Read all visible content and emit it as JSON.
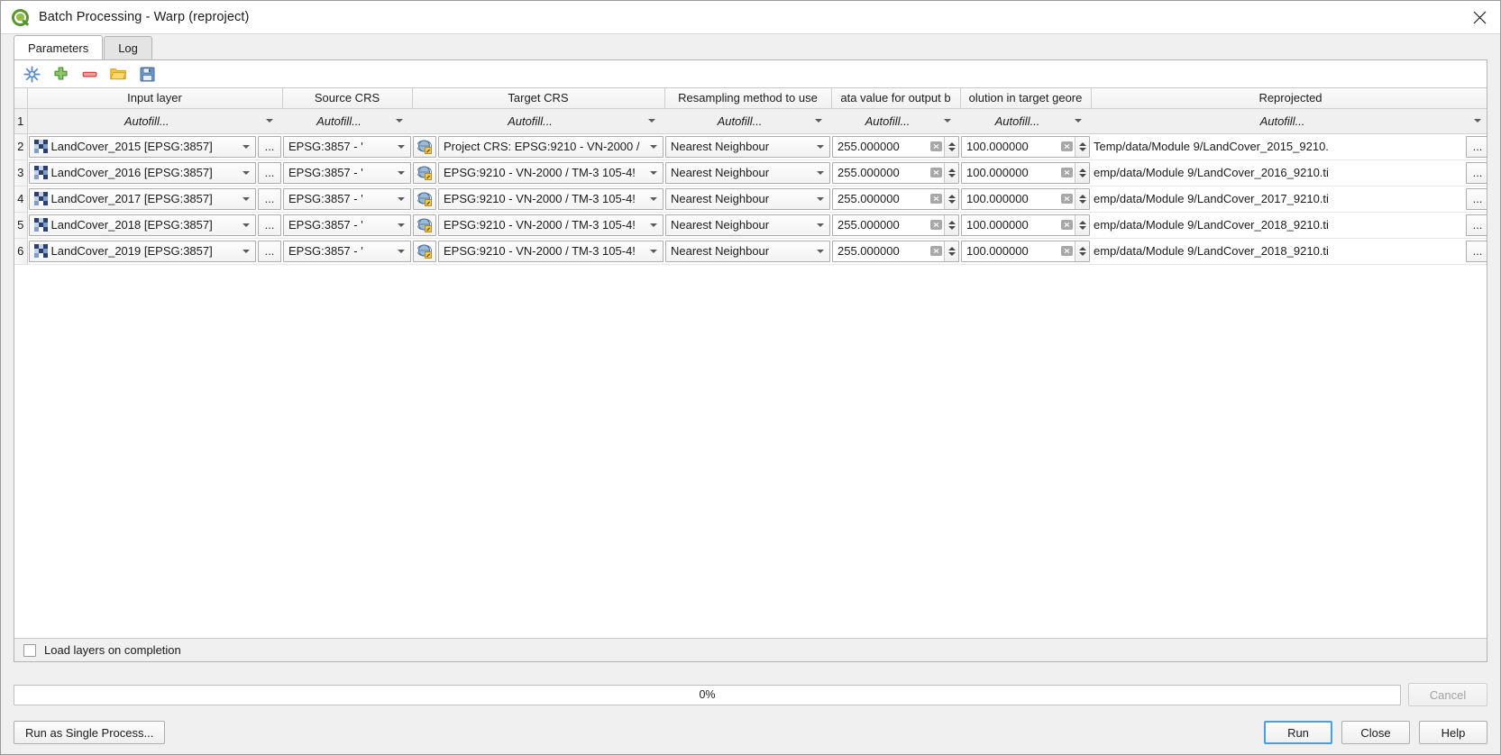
{
  "window": {
    "title": "Batch Processing - Warp (reproject)",
    "logo_icon": "qgis-logo-icon",
    "close_icon": "close-icon"
  },
  "tabs": [
    {
      "label": "Parameters",
      "active": true
    },
    {
      "label": "Log",
      "active": false
    }
  ],
  "toolbar": {
    "buttons": [
      {
        "name": "advanced-parameters-icon",
        "tip": "Advanced parameters"
      },
      {
        "name": "add-row-icon",
        "tip": "Add row"
      },
      {
        "name": "remove-row-icon",
        "tip": "Remove row"
      },
      {
        "name": "open-icon",
        "tip": "Open"
      },
      {
        "name": "save-icon",
        "tip": "Save"
      }
    ]
  },
  "table": {
    "headers": [
      "Input layer",
      "Source CRS",
      "Target CRS",
      "Resampling method to use",
      "ata value for output b",
      "olution in target geore",
      "Reprojected"
    ],
    "autofill_label": "Autofill...",
    "autofill_row_number": "1",
    "browse_label": "...",
    "rows": [
      {
        "number": "2",
        "input_layer": "LandCover_2015 [EPSG:3857]",
        "source_crs": "EPSG:3857 - '",
        "target_crs": "Project CRS: EPSG:9210 - VN-2000 / ",
        "resampling": "Nearest Neighbour",
        "nodata": "255.000000",
        "resolution": "100.000000",
        "output": "Temp/data/Module 9/LandCover_2015_9210."
      },
      {
        "number": "3",
        "input_layer": "LandCover_2016 [EPSG:3857]",
        "source_crs": "EPSG:3857 - '",
        "target_crs": "EPSG:9210 - VN-2000 / TM-3 105-4!",
        "resampling": "Nearest Neighbour",
        "nodata": "255.000000",
        "resolution": "100.000000",
        "output": "emp/data/Module 9/LandCover_2016_9210.ti"
      },
      {
        "number": "4",
        "input_layer": "LandCover_2017 [EPSG:3857]",
        "source_crs": "EPSG:3857 - '",
        "target_crs": "EPSG:9210 - VN-2000 / TM-3 105-4!",
        "resampling": "Nearest Neighbour",
        "nodata": "255.000000",
        "resolution": "100.000000",
        "output": "emp/data/Module 9/LandCover_2017_9210.ti"
      },
      {
        "number": "5",
        "input_layer": "LandCover_2018 [EPSG:3857]",
        "source_crs": "EPSG:3857 - '",
        "target_crs": "EPSG:9210 - VN-2000 / TM-3 105-4!",
        "resampling": "Nearest Neighbour",
        "nodata": "255.000000",
        "resolution": "100.000000",
        "output": "emp/data/Module 9/LandCover_2018_9210.ti"
      },
      {
        "number": "6",
        "input_layer": "LandCover_2019 [EPSG:3857]",
        "source_crs": "EPSG:3857 - '",
        "target_crs": "EPSG:9210 - VN-2000 / TM-3 105-4!",
        "resampling": "Nearest Neighbour",
        "nodata": "255.000000",
        "resolution": "100.000000",
        "output": "emp/data/Module 9/LandCover_2018_9210.ti"
      }
    ],
    "icons": {
      "layer": "raster-layer-icon",
      "crs": "crs-select-icon"
    }
  },
  "footer": {
    "load_layers_label": "Load layers on completion",
    "load_layers_checked": false,
    "progress_text": "0%",
    "progress_percent": 0,
    "cancel_label": "Cancel",
    "cancel_disabled": true,
    "run_single_label": "Run as Single Process...",
    "run_label": "Run",
    "close_label": "Close",
    "help_label": "Help"
  },
  "colors": {
    "accent": "#4a9fe0",
    "window_bg": "#f0f0f0",
    "panel_bg": "#ffffff",
    "logo_green": "#589632"
  }
}
